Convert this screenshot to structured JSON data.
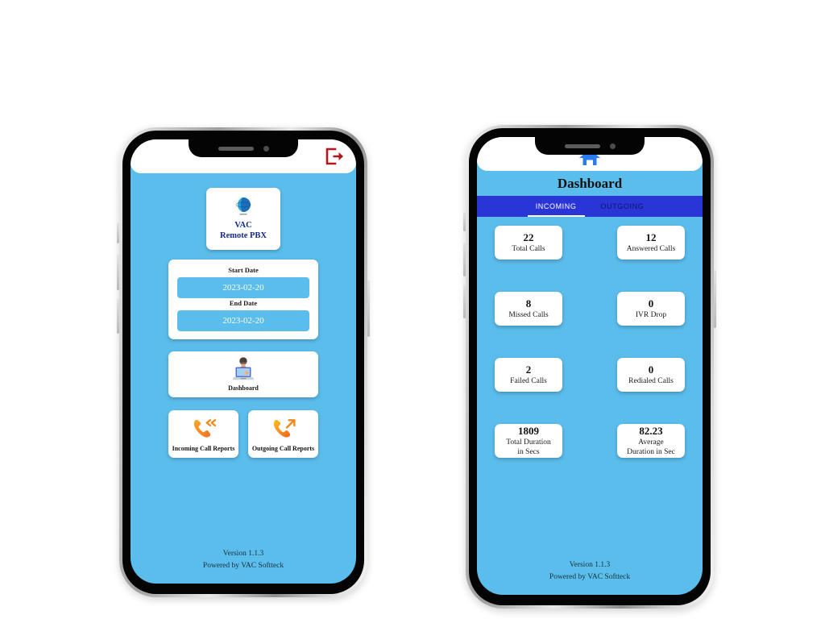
{
  "phone_left": {
    "topbar": {
      "logout_icon": "logout-icon"
    },
    "logo": {
      "icon": "globe-logo-icon",
      "line1": "VAC",
      "line2": "Remote PBX"
    },
    "date_filter": {
      "start_label": "Start Date",
      "start_value": "2023-02-20",
      "end_label": "End Date",
      "end_value": "2023-02-20"
    },
    "dashboard_tile": {
      "icon": "person-at-laptop-icon",
      "label": "Dashboard"
    },
    "report_tiles": [
      {
        "icon": "incoming-call-icon",
        "label": "Incoming Call Reports"
      },
      {
        "icon": "outgoing-call-icon",
        "label": "Outgoing Call Reports"
      }
    ],
    "footer": {
      "version": "Version 1.1.3",
      "powered_by": "Powered by VAC Softteck"
    }
  },
  "phone_right": {
    "topbar": {
      "home_icon": "home-icon"
    },
    "title": "Dashboard",
    "tabs": [
      {
        "label": "INCOMING",
        "active": true
      },
      {
        "label": "OUTGOING",
        "active": false
      }
    ],
    "stats": [
      {
        "value": "22",
        "label": "Total Calls"
      },
      {
        "value": "12",
        "label": "Answered Calls"
      },
      {
        "value": "8",
        "label": "Missed Calls"
      },
      {
        "value": "0",
        "label": "IVR Drop"
      },
      {
        "value": "2",
        "label": "Failed Calls"
      },
      {
        "value": "0",
        "label": "Redialed Calls"
      },
      {
        "value": "1809",
        "label": "Total Duration\nin Secs"
      },
      {
        "value": "82.23",
        "label": "Average\nDuration in Sec"
      }
    ],
    "footer": {
      "version": "Version 1.1.3",
      "powered_by": "Powered by VAC Softteck"
    }
  },
  "colors": {
    "screen_bg": "#5bbdec",
    "tabbar": "#2a35d8",
    "logo_text": "#152a8a",
    "logout": "#b3161b",
    "home": "#2b7cf0",
    "call_icon": "#f5a01d"
  }
}
